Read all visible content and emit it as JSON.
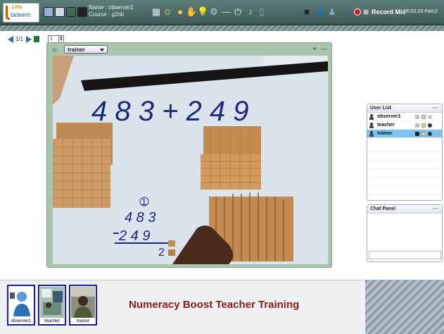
{
  "app": {
    "logo_top": "Lets",
    "logo_bottom": "taleem"
  },
  "session": {
    "name_line": "Name : observer1",
    "course_line": "Course : g2nb"
  },
  "recording": {
    "label": "Record Mic",
    "time": "00:02:23 Part:2"
  },
  "whiteboard_nav": {
    "page_indicator": "1/1",
    "zoom_value": "1"
  },
  "video_panel": {
    "selected_user": "trainer",
    "video_text": {
      "equation": "4 8 3  +  2 4 9",
      "carry": "1",
      "top_number": "4 8 3",
      "bottom_number": "2 4 9",
      "partial": "2"
    }
  },
  "user_list": {
    "title": "User List",
    "users": [
      {
        "name": "observer1",
        "selected": false
      },
      {
        "name": "teacher",
        "selected": false
      },
      {
        "name": "trainer",
        "selected": true
      }
    ]
  },
  "chat_panel": {
    "title": "Chat Panel"
  },
  "thumbnails": [
    {
      "caption": "observer1"
    },
    {
      "caption": "teacher"
    },
    {
      "caption": "trainer"
    }
  ],
  "banner": "Numeracy Boost Teacher Training",
  "colors": {
    "toolbar": "#4b6a66",
    "panel_green": "#a9c6ad",
    "selected_row": "#7fc2f0",
    "banner_text": "#8c1c1c",
    "thumb_border": "#1a1f90"
  }
}
